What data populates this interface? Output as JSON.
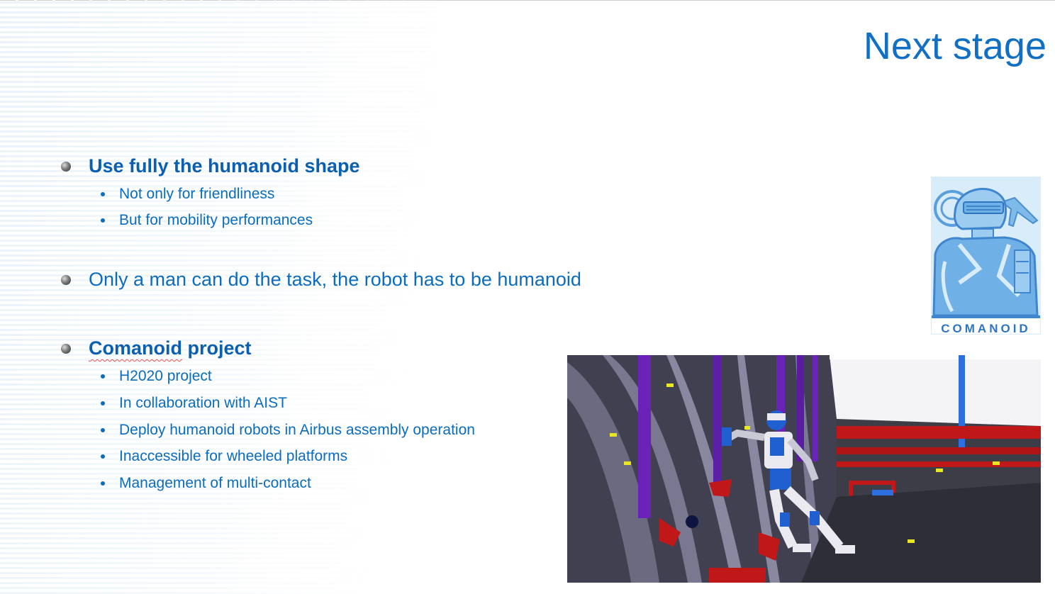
{
  "slide": {
    "title": "Next stage",
    "bullets": [
      {
        "text": "Use fully the humanoid shape",
        "bold": true,
        "sub": [
          "Not only for friendliness",
          "But for mobility performances"
        ]
      },
      {
        "text": "Only a man can do the task, the robot has to be humanoid",
        "bold": false,
        "sub": []
      },
      {
        "text_part1": "Comanoid",
        "text_part2": " project",
        "bold": true,
        "sub": [
          "H2020 project",
          "In collaboration with AIST",
          "Deploy humanoid robots in Airbus assembly operation",
          "Inaccessible for wheeled platforms",
          "Management of multi-contact"
        ]
      }
    ],
    "logo_text": "COMANOID"
  },
  "colors": {
    "title": "#1170c4",
    "text": "#0b6cc0",
    "logo_blue": "#6fb0e6",
    "frame_red": "#c01818",
    "strut_purple": "#6a22b8",
    "robot_blue": "#1f5fd0"
  }
}
